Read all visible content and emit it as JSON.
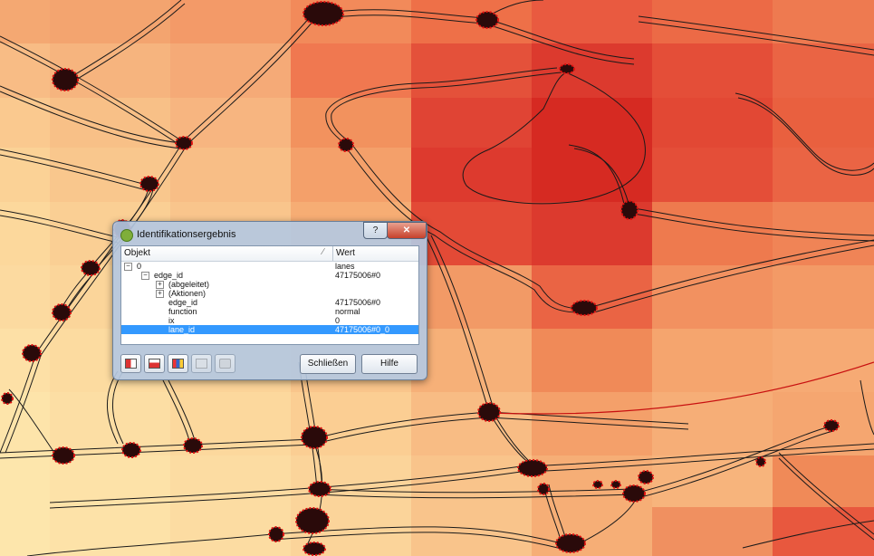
{
  "dialog": {
    "title": "Identifikationsergebnis",
    "help_label": "?",
    "close_label": "✕",
    "columns": {
      "object": "Objekt",
      "value": "Wert"
    },
    "rows": [
      {
        "key": "0",
        "value": "lanes",
        "expander": "minus"
      },
      {
        "key": "edge_id",
        "value": "47175006#0",
        "expander": "minus"
      },
      {
        "key": "(abgeleitet)",
        "value": "",
        "expander": "plus"
      },
      {
        "key": "(Aktionen)",
        "value": "",
        "expander": "plus"
      },
      {
        "key": "edge_id",
        "value": "47175006#0",
        "expander": ""
      },
      {
        "key": "function",
        "value": "normal",
        "expander": ""
      },
      {
        "key": "ix",
        "value": "0",
        "expander": ""
      },
      {
        "key": "lane_id",
        "value": "47175006#0_0",
        "expander": "",
        "selected": true
      }
    ],
    "buttons": {
      "close": "Schließen",
      "help": "Hilfe"
    },
    "toolbar_icons": [
      "expand-tree-icon",
      "collapse-tree-icon",
      "expand-new-icon",
      "copy-icon",
      "print-icon"
    ]
  },
  "colors": {
    "selection": "#3399ff",
    "dark_red": "#d62a22",
    "orange": "#f08a54",
    "light": "#fde6ac"
  }
}
